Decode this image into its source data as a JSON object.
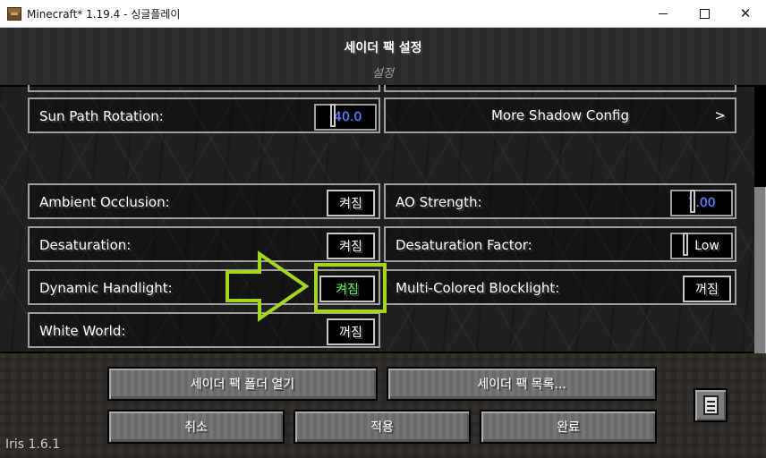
{
  "window": {
    "title": "Minecraft* 1.19.4 - 싱글플레이",
    "minimize_glyph": "",
    "close_glyph": "✕"
  },
  "screen": {
    "title": "세이더 팩 설정",
    "subtitle": "설정"
  },
  "options": {
    "sun_path_rotation": {
      "label": "Sun Path Rotation:",
      "value": "-40.0"
    },
    "more_shadow_config": {
      "label": "More Shadow Config",
      "chevron": ">"
    },
    "ambient_occlusion": {
      "label": "Ambient Occlusion:",
      "value": "켜짐",
      "state": "on"
    },
    "ao_strength": {
      "label": "AO Strength:",
      "value": "1.00"
    },
    "desaturation": {
      "label": "Desaturation:",
      "value": "켜짐",
      "state": "on"
    },
    "desaturation_factor": {
      "label": "Desaturation Factor:",
      "value": "Low"
    },
    "dynamic_handlight": {
      "label": "Dynamic Handlight:",
      "value": "켜짐",
      "state": "on",
      "highlighted": true
    },
    "multi_colored_blocklight": {
      "label": "Multi-Colored Blocklight:",
      "value": "꺼짐",
      "state": "off"
    },
    "white_world": {
      "label": "White World:",
      "value": "꺼짐",
      "state": "off"
    }
  },
  "footer": {
    "open_folder": "세이더 팩 폴더 열기",
    "shader_list": "세이더 팩 목록...",
    "cancel": "취소",
    "apply": "적용",
    "done": "완료"
  },
  "version": "Iris 1.6.1",
  "colors": {
    "highlight": "#a6d520",
    "on_green": "#55ff55",
    "numeric_blue": "#6c8cff"
  },
  "icons": {
    "app": "minecraft-block-icon",
    "arrow": "right-arrow-annotation-icon",
    "doc": "document-icon"
  }
}
